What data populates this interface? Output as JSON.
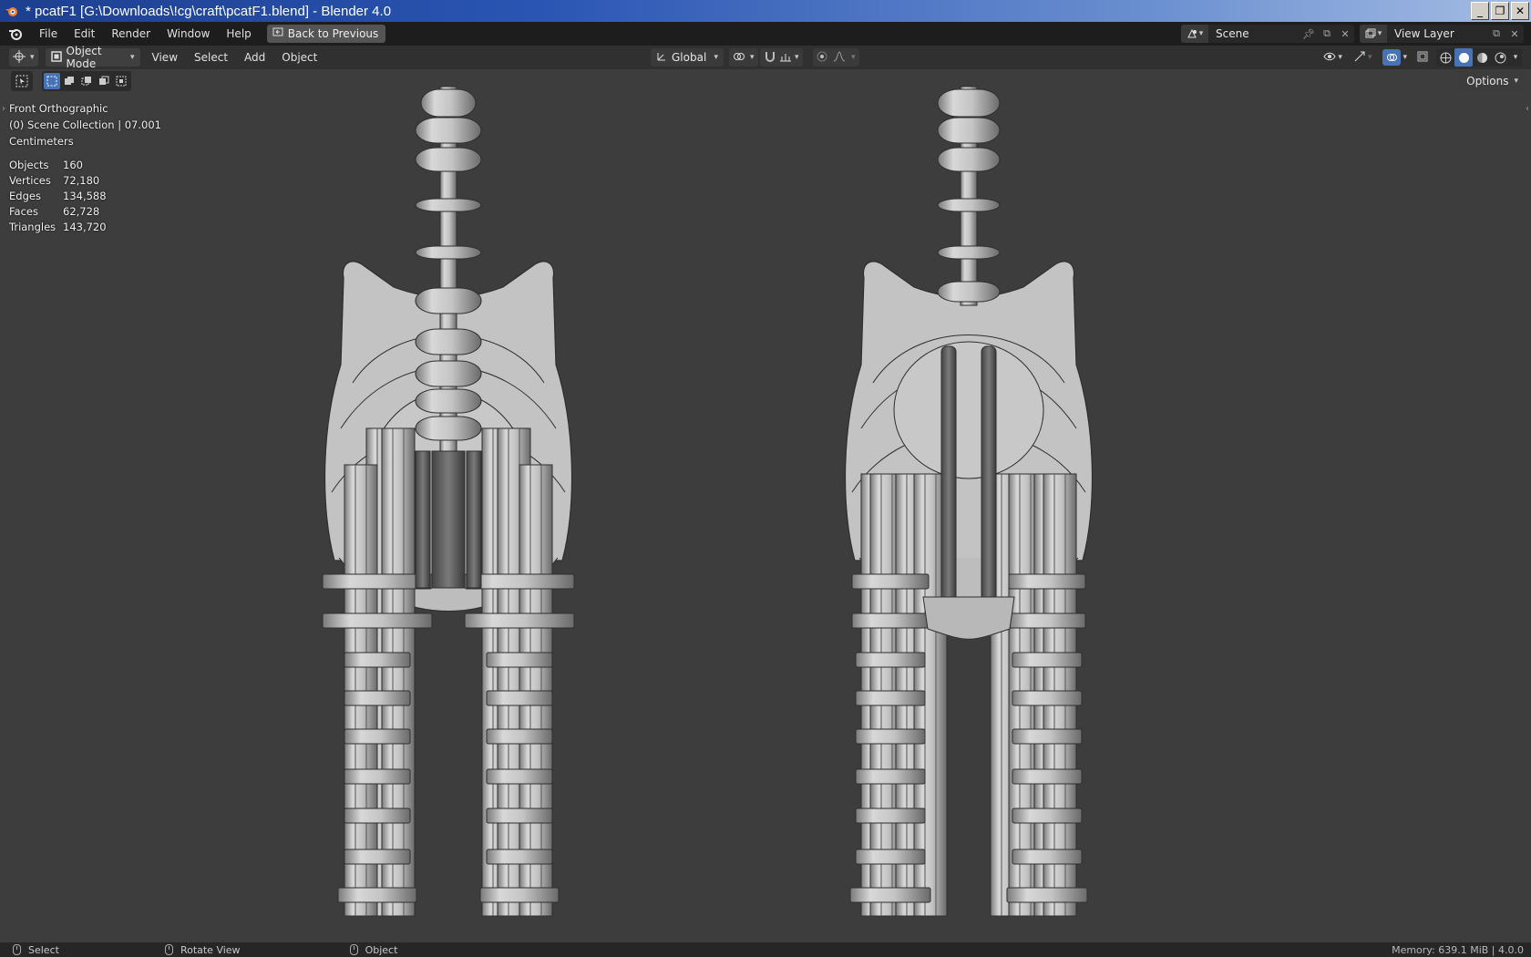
{
  "window": {
    "title": "* pcatF1 [G:\\Downloads\\!cg\\craft\\pcatF1.blend] - Blender 4.0",
    "buttons": {
      "minimize": "_",
      "restore": "❐",
      "close": "✕"
    }
  },
  "menubar": {
    "items": [
      "File",
      "Edit",
      "Render",
      "Window",
      "Help"
    ],
    "back_button": "Back to Previous",
    "scene": "Scene",
    "view_layer": "View Layer"
  },
  "header": {
    "mode": "Object Mode",
    "menus": [
      "View",
      "Select",
      "Add",
      "Object"
    ],
    "orientation": "Global"
  },
  "viewport": {
    "view_name": "Front Orthographic",
    "collection": "(0) Scene Collection | 07.001",
    "units": "Centimeters",
    "options": "Options",
    "stats": [
      {
        "label": "Objects",
        "value": "160"
      },
      {
        "label": "Vertices",
        "value": "72,180"
      },
      {
        "label": "Edges",
        "value": "134,588"
      },
      {
        "label": "Faces",
        "value": "62,728"
      },
      {
        "label": "Triangles",
        "value": "143,720"
      }
    ]
  },
  "statusbar": {
    "select": "Select",
    "rotate": "Rotate View",
    "object": "Object",
    "memory": "Memory: 639.1 MiB | 4.0.0"
  },
  "colors": {
    "viewport_bg": "#3d3d3d",
    "accent": "#4772b3",
    "model": "#c2c2c2"
  }
}
